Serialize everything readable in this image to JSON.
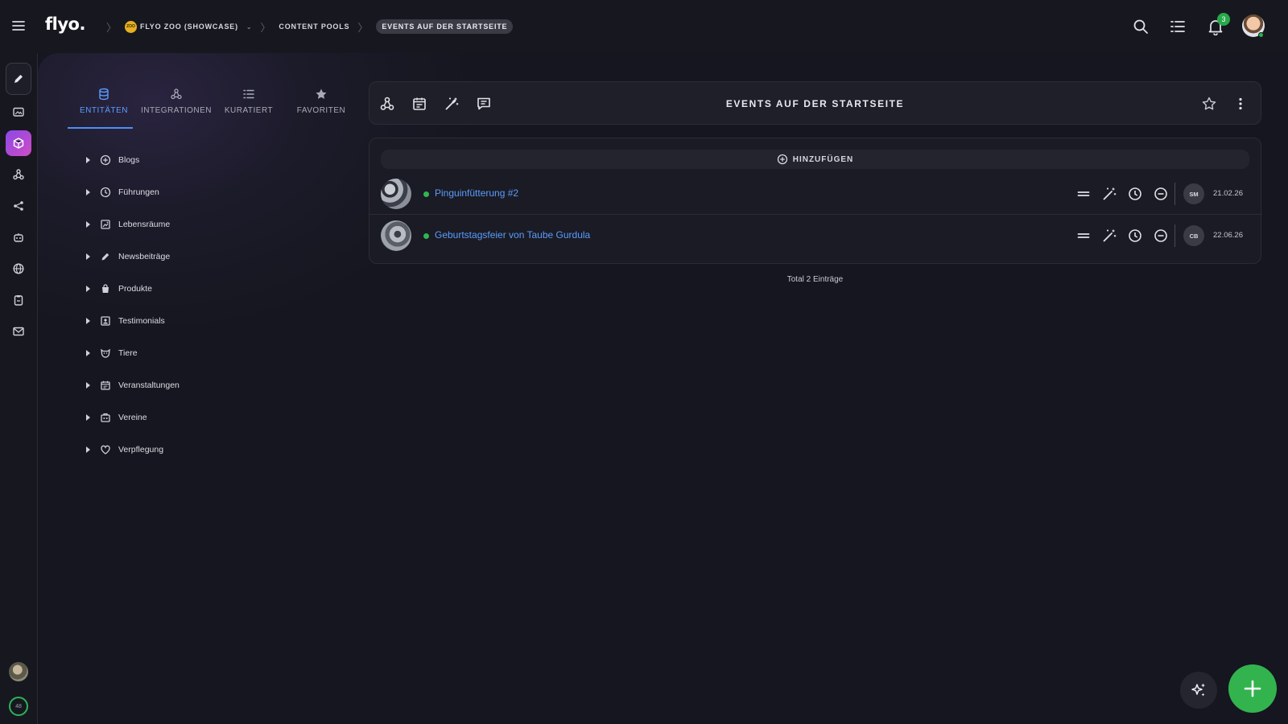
{
  "app": {
    "logo": "flyo."
  },
  "breadcrumbs": {
    "workspace_badge": "ZOO",
    "workspace": "FLYO ZOO (SHOWCASE)",
    "workspace_caret": "⌄",
    "section": "CONTENT POOLS",
    "current": "EVENTS AUF DER STARTSEITE"
  },
  "header": {
    "notification_count": "3"
  },
  "rail": {
    "progress": "48"
  },
  "tabs": [
    {
      "label": "ENTITÄTEN",
      "icon": "database-icon",
      "active": true
    },
    {
      "label": "INTEGRATIONEN",
      "icon": "webhook-icon"
    },
    {
      "label": "KURATIERT",
      "icon": "list-icon"
    },
    {
      "label": "FAVORITEN",
      "icon": "star-icon"
    }
  ],
  "entities": [
    {
      "label": "Blogs",
      "icon": "add-circle-icon"
    },
    {
      "label": "Führungen",
      "icon": "clock-icon"
    },
    {
      "label": "Lebensräume",
      "icon": "map-icon"
    },
    {
      "label": "Newsbeiträge",
      "icon": "pencil-icon"
    },
    {
      "label": "Produkte",
      "icon": "bag-icon"
    },
    {
      "label": "Testimonials",
      "icon": "portrait-icon"
    },
    {
      "label": "Tiere",
      "icon": "pet-icon"
    },
    {
      "label": "Veranstaltungen",
      "icon": "calendar-icon"
    },
    {
      "label": "Vereine",
      "icon": "group-icon"
    },
    {
      "label": "Verpflegung",
      "icon": "heart-icon"
    }
  ],
  "pool": {
    "title": "EVENTS AUF DER STARTSEITE",
    "add_label": "HINZUFÜGEN",
    "entries": [
      {
        "title": "Pinguinfütterung #2",
        "initials": "SM",
        "date": "21.02.26",
        "status": "published"
      },
      {
        "title": "Geburtstagsfeier von Taube Gurdula",
        "initials": "CB",
        "date": "22.06.26",
        "status": "published"
      }
    ],
    "total": "Total 2 Einträge"
  },
  "colors": {
    "accent": "#4f8ef7",
    "link": "#5b9cff",
    "success": "#33b34e",
    "background": "#15161f",
    "rail_active": "#b64bd6"
  }
}
